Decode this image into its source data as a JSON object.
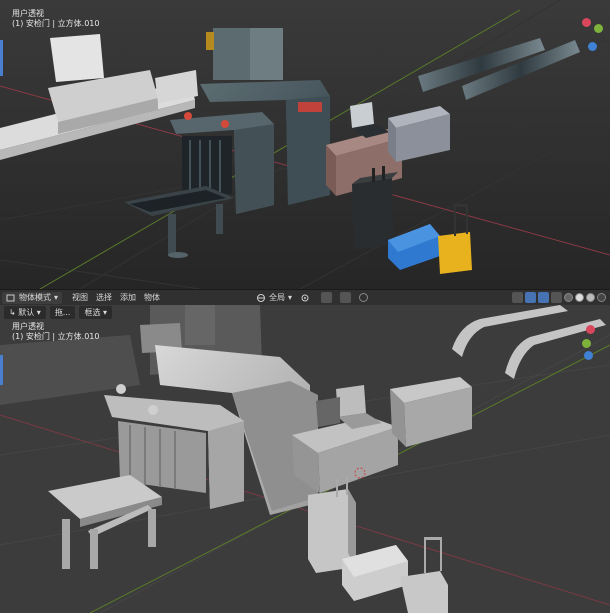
{
  "top_view": {
    "view_name": "用户透视",
    "object_info": "(1) 安检门 | 立方体.010"
  },
  "bottom_view": {
    "view_name": "用户透视",
    "object_info": "(1) 安检门 | 立方体.010"
  },
  "header": {
    "mode_label": "物体模式",
    "menus": [
      "视图",
      "选择",
      "添加",
      "物体"
    ],
    "transform_orientation": "全局"
  },
  "subheader": {
    "pivot_label": "默认",
    "drag_label": "拖...",
    "select_label": "框选"
  },
  "colors": {
    "accent": "#4772b3",
    "gizmo_x": "#d9475c",
    "gizmo_y": "#7db33a",
    "gizmo_z": "#3f82d4"
  }
}
